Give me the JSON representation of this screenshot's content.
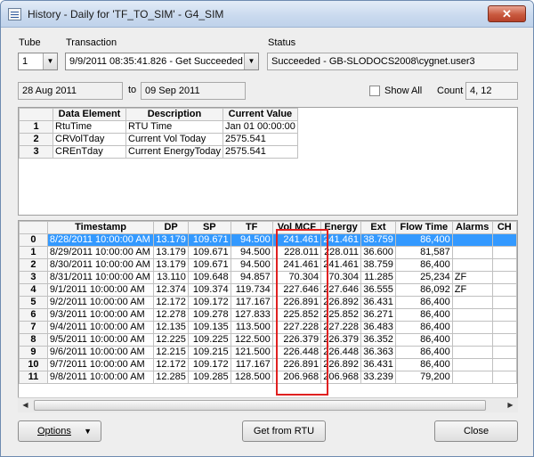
{
  "window": {
    "title": "History - Daily for 'TF_TO_SIM' - G4_SIM",
    "close_label": "✕"
  },
  "header": {
    "tube_label": "Tube",
    "tube_value": "1",
    "transaction_label": "Transaction",
    "transaction_value": "9/9/2011 08:35:41.826 - Get Succeeded",
    "status_label": "Status",
    "status_value": "Succeeded - GB-SLODOCS2008\\cygnet.user3"
  },
  "range": {
    "from": "28 Aug 2011",
    "to_label": "to",
    "to": "09 Sep 2011",
    "show_all_label": "Show All",
    "count_label": "Count",
    "count_value": "4, 12"
  },
  "elements_table": {
    "headers": [
      "Data Element",
      "Description",
      "Current Value"
    ],
    "rows": [
      {
        "idx": "1",
        "element": "RtuTime",
        "description": "RTU Time",
        "value": "Jan 01 00:00:00"
      },
      {
        "idx": "2",
        "element": "CRVolTday",
        "description": "Current Vol Today",
        "value": "2575.541"
      },
      {
        "idx": "3",
        "element": "CREnTday",
        "description": "Current EnergyToday",
        "value": "2575.541"
      }
    ]
  },
  "history_table": {
    "headers": [
      "Timestamp",
      "DP",
      "SP",
      "TF",
      "Vol MCF",
      "Energy",
      "Ext",
      "Flow Time",
      "Alarms",
      "CH"
    ],
    "rows": [
      {
        "idx": "0",
        "ts": "8/28/2011 10:00:00 AM",
        "dp": "13.179",
        "sp": "109.671",
        "tf": "94.500",
        "vol": "241.461",
        "energy": "241.461",
        "ext": "38.759",
        "flow": "86,400",
        "alarms": ""
      },
      {
        "idx": "1",
        "ts": "8/29/2011 10:00:00 AM",
        "dp": "13.179",
        "sp": "109.671",
        "tf": "94.500",
        "vol": "228.011",
        "energy": "228.011",
        "ext": "36.600",
        "flow": "81,587",
        "alarms": ""
      },
      {
        "idx": "2",
        "ts": "8/30/2011 10:00:00 AM",
        "dp": "13.179",
        "sp": "109.671",
        "tf": "94.500",
        "vol": "241.461",
        "energy": "241.461",
        "ext": "38.759",
        "flow": "86,400",
        "alarms": ""
      },
      {
        "idx": "3",
        "ts": "8/31/2011 10:00:00 AM",
        "dp": "13.110",
        "sp": "109.648",
        "tf": "94.857",
        "vol": "70.304",
        "energy": "70.304",
        "ext": "11.285",
        "flow": "25,234",
        "alarms": "ZF"
      },
      {
        "idx": "4",
        "ts": "9/1/2011 10:00:00 AM",
        "dp": "12.374",
        "sp": "109.374",
        "tf": "119.734",
        "vol": "227.646",
        "energy": "227.646",
        "ext": "36.555",
        "flow": "86,092",
        "alarms": "ZF"
      },
      {
        "idx": "5",
        "ts": "9/2/2011 10:00:00 AM",
        "dp": "12.172",
        "sp": "109.172",
        "tf": "117.167",
        "vol": "226.891",
        "energy": "226.892",
        "ext": "36.431",
        "flow": "86,400",
        "alarms": ""
      },
      {
        "idx": "6",
        "ts": "9/3/2011 10:00:00 AM",
        "dp": "12.278",
        "sp": "109.278",
        "tf": "127.833",
        "vol": "225.852",
        "energy": "225.852",
        "ext": "36.271",
        "flow": "86,400",
        "alarms": ""
      },
      {
        "idx": "7",
        "ts": "9/4/2011 10:00:00 AM",
        "dp": "12.135",
        "sp": "109.135",
        "tf": "113.500",
        "vol": "227.228",
        "energy": "227.228",
        "ext": "36.483",
        "flow": "86,400",
        "alarms": ""
      },
      {
        "idx": "8",
        "ts": "9/5/2011 10:00:00 AM",
        "dp": "12.225",
        "sp": "109.225",
        "tf": "122.500",
        "vol": "226.379",
        "energy": "226.379",
        "ext": "36.352",
        "flow": "86,400",
        "alarms": ""
      },
      {
        "idx": "9",
        "ts": "9/6/2011 10:00:00 AM",
        "dp": "12.215",
        "sp": "109.215",
        "tf": "121.500",
        "vol": "226.448",
        "energy": "226.448",
        "ext": "36.363",
        "flow": "86,400",
        "alarms": ""
      },
      {
        "idx": "10",
        "ts": "9/7/2011 10:00:00 AM",
        "dp": "12.172",
        "sp": "109.172",
        "tf": "117.167",
        "vol": "226.891",
        "energy": "226.892",
        "ext": "36.431",
        "flow": "86,400",
        "alarms": ""
      },
      {
        "idx": "11",
        "ts": "9/8/2011 10:00:00 AM",
        "dp": "12.285",
        "sp": "109.285",
        "tf": "128.500",
        "vol": "206.968",
        "energy": "206.968",
        "ext": "33.239",
        "flow": "79,200",
        "alarms": ""
      }
    ]
  },
  "scrollbar": {
    "left_arrow": "◀",
    "right_arrow": "▶"
  },
  "footer": {
    "options_label": "Options",
    "get_from_rtu_label": "Get from RTU",
    "close_label": "Close"
  },
  "colors": {
    "selection": "#3399ff",
    "highlight_border": "#e02020"
  }
}
